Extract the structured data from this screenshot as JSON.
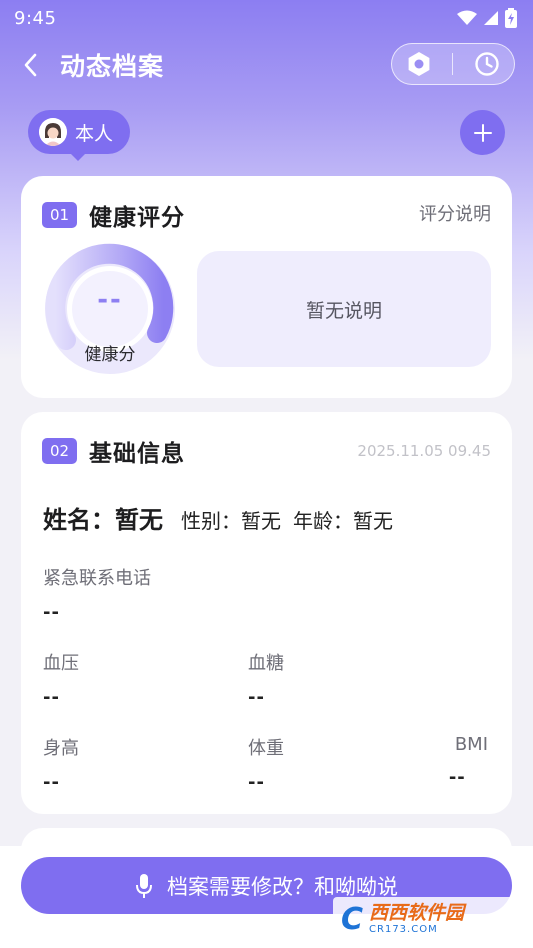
{
  "status_bar": {
    "time": "9:45"
  },
  "header": {
    "title": "动态档案"
  },
  "profile": {
    "chip_label": "本人"
  },
  "health": {
    "number": "01",
    "title": "健康评分",
    "link": "评分说明",
    "score_value": "--",
    "score_label": "健康分",
    "description": "暂无说明"
  },
  "basic": {
    "number": "02",
    "title": "基础信息",
    "updated_at": "2025.11.05 09.45",
    "name_line": "姓名：暂无",
    "gender_line": "性别：暂无",
    "age_line": "年龄：暂无",
    "fields": [
      {
        "label": "紧急联系电话",
        "value": "--"
      },
      {
        "label": "血压",
        "value": "--"
      },
      {
        "label": "血糖",
        "value": "--"
      },
      {
        "label": "身高",
        "value": "--"
      },
      {
        "label": "体重",
        "value": "--"
      },
      {
        "label": "BMI",
        "value": "--"
      }
    ]
  },
  "footer": {
    "voice_button": "档案需要修改？和呦呦说"
  },
  "watermark": {
    "letter": "C",
    "title": "西西软件园",
    "sub": "CR173.COM"
  },
  "colors": {
    "accent": "#7f6ef0",
    "gauge_light": "#ded9fb",
    "card_bg": "#ffffff"
  }
}
